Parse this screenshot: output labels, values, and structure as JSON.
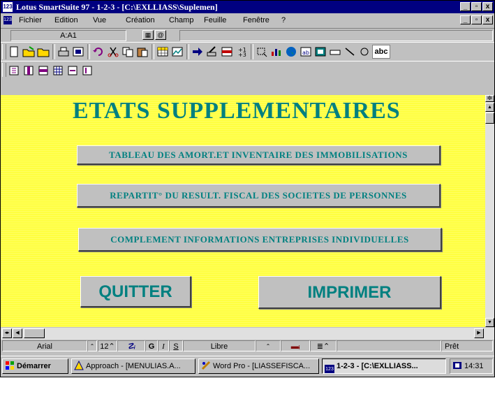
{
  "window": {
    "app_icon": "123",
    "title": "Lotus SmartSuite 97   - 1-2-3 - [C:\\EXLLIASS\\Suplemen]",
    "minimize": "_",
    "maximize": "▫",
    "close": "x"
  },
  "menu": {
    "icon": "123",
    "items": [
      "Fichier",
      "Edition",
      "Vue",
      "Création",
      "Champ",
      "Feuille",
      "Fenêtre",
      "?"
    ]
  },
  "range": {
    "address": "A:A1"
  },
  "sheet": {
    "heading": "ETATS SUPPLEMENTAIRES",
    "buttons": [
      "TABLEAU DES AMORT.ET INVENTAIRE DES IMMOBILISATIONS",
      "REPARTIT° DU RESULT. FISCAL DES SOCIETES DE PERSONNES",
      "COMPLEMENT INFORMATIONS ENTREPRISES INDIVIDUELLES"
    ],
    "quit": "QUITTER",
    "print": "IMPRIMER"
  },
  "status": {
    "font": "Arial",
    "size": "12",
    "bold": "G",
    "italic": "I",
    "underline": "S",
    "mode": "Libre",
    "ready": "Prêt"
  },
  "taskbar": {
    "start": "Démarrer",
    "tasks": [
      "Approach - [MENULIAS.A...",
      "Word Pro - [LIASSEFISCA...",
      "1-2-3 - [C:\\EXLLIASS..."
    ],
    "clock": "14:31"
  },
  "colors": {
    "title_bar": "#000080",
    "canvas": "#ffff40",
    "heading": "#008080",
    "button_face": "#c0c0c0"
  }
}
